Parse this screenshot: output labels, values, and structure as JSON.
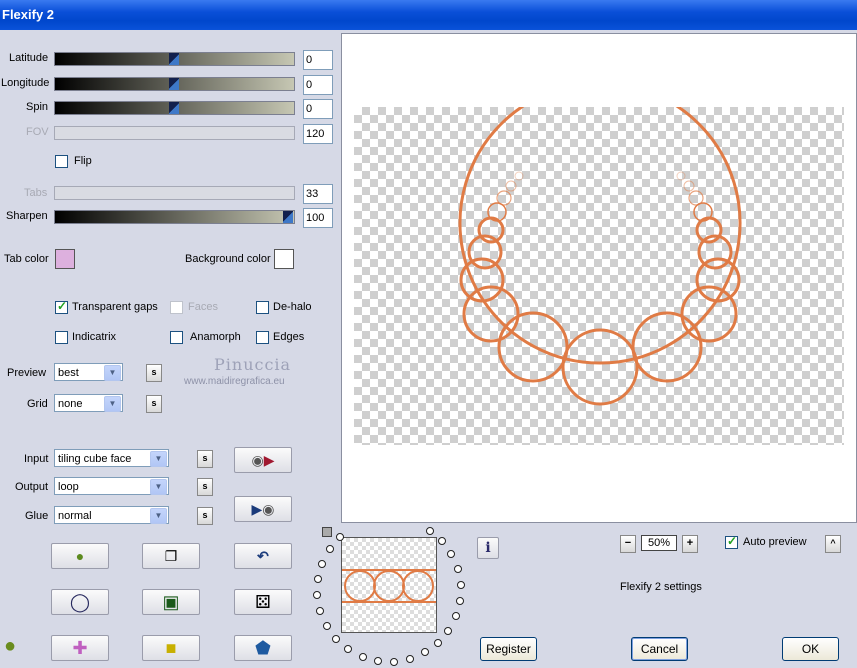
{
  "window": {
    "title": "Flexify 2"
  },
  "params": {
    "latitude": {
      "label": "Latitude",
      "value": "0"
    },
    "longitude": {
      "label": "Longitude",
      "value": "0"
    },
    "spin": {
      "label": "Spin",
      "value": "0"
    },
    "fov": {
      "label": "FOV",
      "value": "120"
    },
    "flip": {
      "label": "Flip",
      "checked": false
    },
    "tabs": {
      "label": "Tabs",
      "value": "33"
    },
    "sharpen": {
      "label": "Sharpen",
      "value": "100"
    }
  },
  "colors": {
    "tab_color_label": "Tab color",
    "tab_color": "#ddb0de",
    "background_color_label": "Background color",
    "background_color": "#ffffff",
    "curve_color": "#e07b45"
  },
  "options": {
    "transparent_gaps": {
      "label": "Transparent gaps",
      "checked": true
    },
    "faces": {
      "label": "Faces",
      "checked": false
    },
    "de_halo": {
      "label": "De-halo",
      "checked": false
    },
    "indicatrix": {
      "label": "Indicatrix",
      "checked": false
    },
    "anamorph": {
      "label": "Anamorph",
      "checked": false
    },
    "edges": {
      "label": "Edges",
      "checked": false
    }
  },
  "watermark": {
    "name": "Pinuccia",
    "url": "www.maidiregrafica.eu"
  },
  "view": {
    "preview": {
      "label": "Preview",
      "value": "best"
    },
    "grid": {
      "label": "Grid",
      "value": "none"
    }
  },
  "mapping": {
    "input": {
      "label": "Input",
      "value": "tiling cube face"
    },
    "output": {
      "label": "Output",
      "value": "loop"
    },
    "glue": {
      "label": "Glue",
      "value": "normal"
    }
  },
  "small_button_glyph": "s",
  "zoom": {
    "minus": "−",
    "value": "50%",
    "plus": "+"
  },
  "auto_preview": {
    "label": "Auto preview",
    "checked": true
  },
  "expand_glyph": "^",
  "settings_title": "Flexify 2 settings",
  "info_glyph": "i",
  "buttons": {
    "register": "Register",
    "cancel": "Cancel",
    "ok": "OK"
  }
}
